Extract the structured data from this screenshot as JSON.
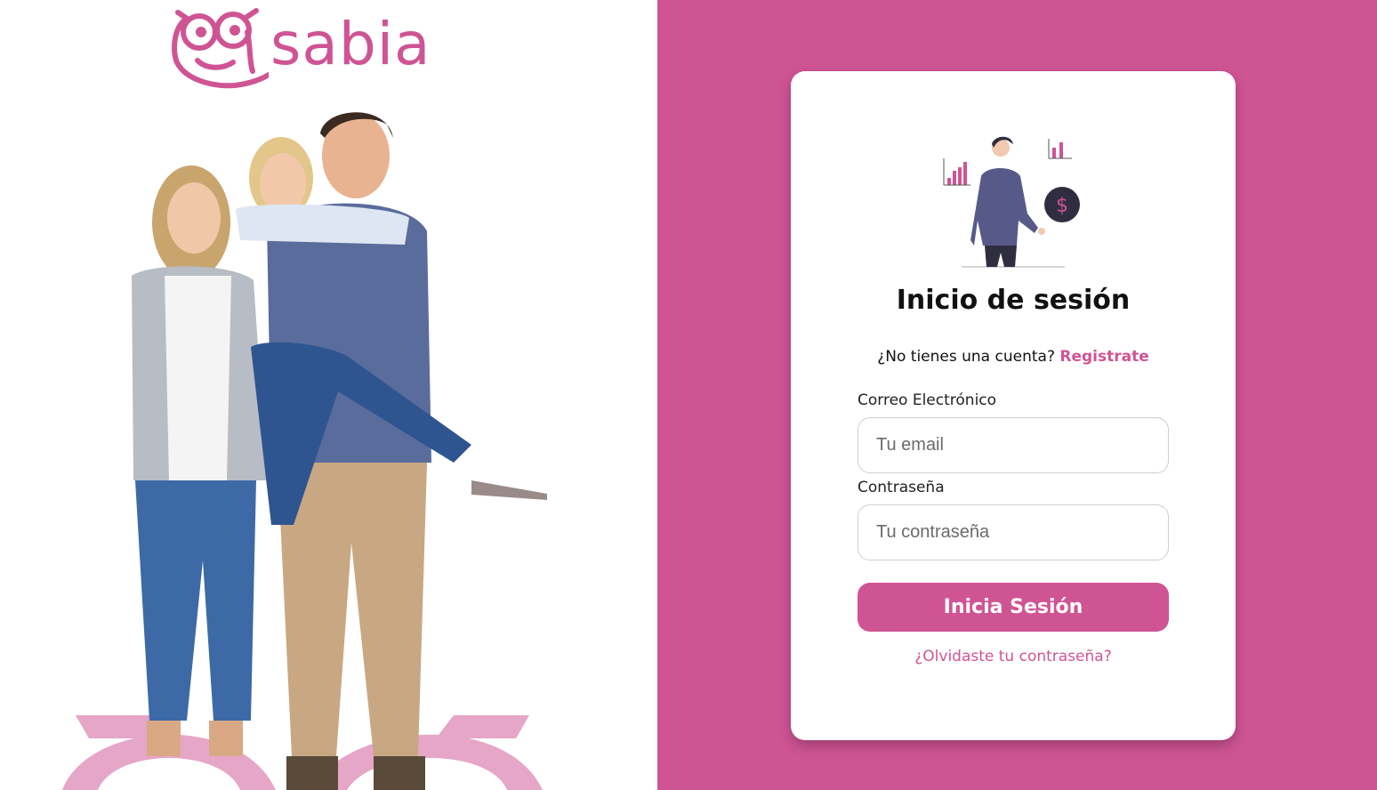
{
  "brand": {
    "name": "sabia",
    "color": "#cf5494"
  },
  "hero": {
    "image": "family-photo"
  },
  "login": {
    "title": "Inicio de sesión",
    "signup_prompt": "¿No tienes una cuenta?",
    "signup_link": "Registrate",
    "email_label": "Correo Electrónico",
    "email_placeholder": "Tu email",
    "password_label": "Contraseña",
    "password_placeholder": "Tu contraseña",
    "submit_label": "Inicia Sesión",
    "forgot_link": "¿Olvidaste tu contraseña?"
  }
}
